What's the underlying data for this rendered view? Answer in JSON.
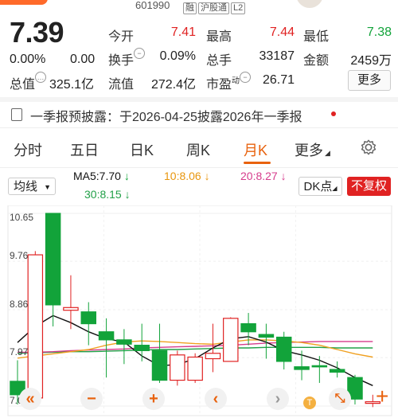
{
  "header": {
    "stock_code": "601990",
    "tags": [
      "融",
      "沪股通",
      "L2"
    ]
  },
  "quote": {
    "price": "7.39",
    "change_pct": "0.00%",
    "change": "0.00",
    "market_cap_label": "总值",
    "market_cap": "325.1亿",
    "open_label": "今开",
    "open": "7.41",
    "high_label": "最高",
    "high": "7.44",
    "low_label": "最低",
    "low": "7.38",
    "turnover_label": "换手",
    "turnover": "0.09%",
    "volume_label": "总手",
    "volume": "33187",
    "amount_label": "金额",
    "amount": "2459万",
    "float_cap_label": "流值",
    "float_cap": "272.4亿",
    "pe_label": "市盈",
    "pe_superscript": "动",
    "pe": "26.71",
    "more_label": "更多"
  },
  "notice": {
    "text": "一季报预披露：于2026-04-25披露2026年一季报"
  },
  "tabs": [
    {
      "label": "分时"
    },
    {
      "label": "五日"
    },
    {
      "label": "日K"
    },
    {
      "label": "周K"
    },
    {
      "label": "月K",
      "active": true
    },
    {
      "label": "更多"
    }
  ],
  "chart_toolbar": {
    "indicator_select": "均线",
    "ma5": "MA5:7.70",
    "ma10": "10:8.06",
    "ma20": "20:8.27",
    "ma30": "30:8.15",
    "dk_label": "DK点",
    "fq_label": "不复权"
  },
  "colors": {
    "up": "#e02222",
    "down": "#12a33a",
    "accent": "#e8620e",
    "ma5": "#111111",
    "ma10": "#f0a020",
    "ma20": "#d63c8c",
    "ma30": "#22a048"
  },
  "chart_data": {
    "type": "candlestick",
    "y_ticks": [
      "10.65",
      "9.76",
      "8.86",
      "7.97",
      "7.07"
    ],
    "ylim": [
      7.07,
      10.65
    ],
    "candles": [
      {
        "o": 7.53,
        "h": 7.92,
        "c": 7.28,
        "l": 7.1
      },
      {
        "o": 7.22,
        "h": 9.95,
        "c": 9.88,
        "l": 7.1
      },
      {
        "o": 10.65,
        "h": 10.65,
        "c": 8.95,
        "l": 8.55
      },
      {
        "o": 8.85,
        "h": 9.5,
        "c": 8.9,
        "l": 8.5
      },
      {
        "o": 8.82,
        "h": 9.0,
        "c": 8.6,
        "l": 8.2
      },
      {
        "o": 8.45,
        "h": 8.7,
        "c": 8.3,
        "l": 7.6
      },
      {
        "o": 8.3,
        "h": 8.5,
        "c": 8.22,
        "l": 7.85
      },
      {
        "o": 8.2,
        "h": 8.6,
        "c": 8.1,
        "l": 7.9
      },
      {
        "o": 8.1,
        "h": 8.6,
        "c": 7.55,
        "l": 7.5
      },
      {
        "o": 7.55,
        "h": 8.1,
        "c": 8.02,
        "l": 7.45
      },
      {
        "o": 7.55,
        "h": 8.05,
        "c": 7.98,
        "l": 7.5
      },
      {
        "o": 7.95,
        "h": 8.6,
        "c": 8.05,
        "l": 7.7
      },
      {
        "o": 7.9,
        "h": 8.72,
        "c": 8.7,
        "l": 7.9
      },
      {
        "o": 8.6,
        "h": 8.8,
        "c": 8.45,
        "l": 8.2
      },
      {
        "o": 8.4,
        "h": 8.6,
        "c": 8.35,
        "l": 7.95
      },
      {
        "o": 8.35,
        "h": 8.45,
        "c": 7.9,
        "l": 7.75
      },
      {
        "o": 7.8,
        "h": 8.1,
        "c": 7.75,
        "l": 7.55
      },
      {
        "o": 7.82,
        "h": 8.0,
        "c": 7.8,
        "l": 7.5
      },
      {
        "o": 7.75,
        "h": 7.9,
        "c": 7.7,
        "l": 7.6
      },
      {
        "o": 7.6,
        "h": 7.65,
        "c": 7.2,
        "l": 7.1
      },
      {
        "o": 7.12,
        "h": 7.28,
        "c": 7.15,
        "l": 7.05
      }
    ],
    "ma5": [
      8.25,
      8.55,
      8.75,
      8.62,
      8.45,
      8.32,
      8.26,
      8.0,
      7.82,
      7.84,
      7.95,
      8.15,
      8.32,
      8.36,
      8.26,
      8.1,
      8.02,
      7.92,
      7.78,
      7.6,
      7.45
    ],
    "ma10": [
      7.96,
      8.0,
      8.04,
      8.08,
      8.12,
      8.2,
      8.26,
      8.28,
      8.27,
      8.25,
      8.23,
      8.22,
      8.26,
      8.3,
      8.3,
      8.28,
      8.25,
      8.2,
      8.12,
      8.04,
      7.98
    ],
    "ma20": [
      8.07,
      8.07,
      8.08,
      8.1,
      8.11,
      8.12,
      8.13,
      8.15,
      8.16,
      8.17,
      8.18,
      8.19,
      8.2,
      8.22,
      8.24,
      8.25,
      8.26,
      8.27,
      8.27,
      8.27,
      8.27
    ],
    "ma30": [
      8.05,
      8.06,
      8.07,
      8.08,
      8.08,
      8.09,
      8.1,
      8.11,
      8.12,
      8.12,
      8.13,
      8.14,
      8.15,
      8.15,
      8.16,
      8.16,
      8.16,
      8.16,
      8.15,
      8.15,
      8.15
    ]
  }
}
